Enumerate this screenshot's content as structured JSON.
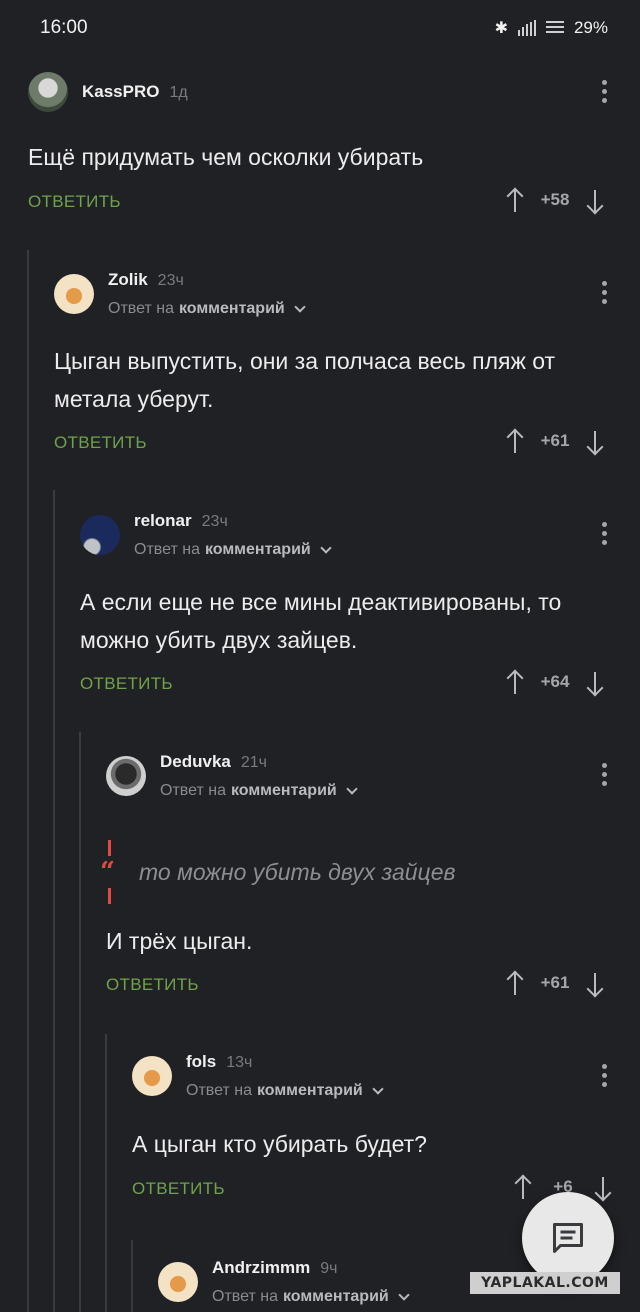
{
  "status": {
    "time": "16:00",
    "battery": "29%"
  },
  "reply_label": "ОТВЕТИТЬ",
  "reply_to_prefix": "Ответ на",
  "reply_to_target": "комментарий",
  "comments": [
    {
      "author": "KassPRO",
      "time": "1д",
      "text": "Ещё придумать чем осколки убирать",
      "score": "+58"
    },
    {
      "author": "Zolik",
      "time": "23ч",
      "text": "Цыган выпустить, они за полчаса весь пляж от метала уберут.",
      "score": "+61"
    },
    {
      "author": "relonar",
      "time": "23ч",
      "text": "А если еще не все мины деактивированы, то можно убить двух зайцев.",
      "score": "+64"
    },
    {
      "author": "Deduvka",
      "time": "21ч",
      "quote": "то можно убить двух зайцев",
      "text": "И трёх цыган.",
      "score": "+61"
    },
    {
      "author": "fols",
      "time": "13ч",
      "text": "А цыган кто убирать будет?",
      "score": "+6"
    },
    {
      "author": "Andrzimmm",
      "time": "9ч"
    }
  ],
  "watermark": "YAPLAKAL.COM",
  "colors": {
    "background": "#202124",
    "reply": "#6fa34b",
    "quote": "#e5483f"
  }
}
